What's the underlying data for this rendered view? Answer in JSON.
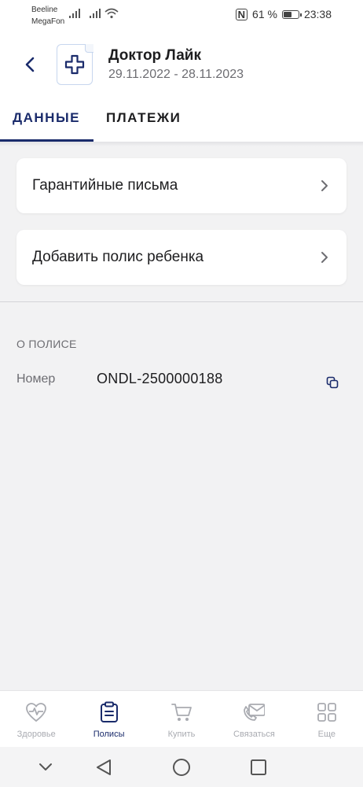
{
  "status_bar": {
    "carrier1": "Beeline",
    "carrier2": "MegaFon",
    "nfc": "N",
    "battery": "61 %",
    "battery_level": 0.61,
    "time": "23:38"
  },
  "header": {
    "title": "Доктор Лайк",
    "dates": "29.11.2022 - 28.11.2023"
  },
  "tabs": [
    {
      "label": "ДАННЫЕ",
      "active": true
    },
    {
      "label": "ПЛАТЕЖИ",
      "active": false
    }
  ],
  "cards": [
    {
      "label": "Гарантийные письма"
    },
    {
      "label": "Добавить полис ребенка"
    }
  ],
  "policy": {
    "section_title": "О ПОЛИСЕ",
    "number_label": "Номер",
    "number_value": "ONDL-2500000188"
  },
  "bottom_nav": [
    {
      "label": "Здоровье",
      "icon": "health-icon",
      "active": false
    },
    {
      "label": "Полисы",
      "icon": "policy-icon",
      "active": true
    },
    {
      "label": "Купить",
      "icon": "cart-icon",
      "active": false
    },
    {
      "label": "Связаться",
      "icon": "contact-icon",
      "active": false
    },
    {
      "label": "Еще",
      "icon": "grid-icon",
      "active": false
    }
  ],
  "colors": {
    "accent": "#1a2b6b",
    "inactive": "#a9abb1",
    "background": "#f2f2f3"
  }
}
